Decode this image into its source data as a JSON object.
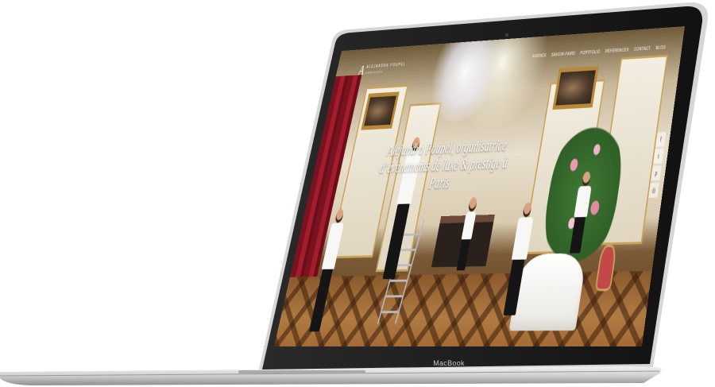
{
  "device": {
    "brand_label": "MacBook"
  },
  "site": {
    "logo": {
      "mark": "A",
      "name": "ALEJANDRA POUPEL",
      "tagline": "LUXURY EVENTS"
    },
    "nav": {
      "items": [
        {
          "label": "AGENCE"
        },
        {
          "label": "SAVOIR-FAIRE"
        },
        {
          "label": "PORTFOLIO"
        },
        {
          "label": "RÉFÉRENCES"
        },
        {
          "label": "CONTACT"
        },
        {
          "label": "BLOG"
        }
      ]
    },
    "hero": {
      "title": "Alejandra Poupel, organisatrice d’événements de luxe & prestige à Paris"
    },
    "social": [
      {
        "icon": "facebook-icon",
        "glyph": "f"
      },
      {
        "icon": "twitter-icon",
        "glyph": "t"
      },
      {
        "icon": "pinterest-icon",
        "glyph": "p"
      },
      {
        "icon": "instagram-icon",
        "glyph": "◎"
      }
    ]
  },
  "colors": {
    "frame": "#0d0d0d",
    "base": "#c9c9c9",
    "gold": "#c9a35a",
    "curtain": "#8a1625"
  }
}
